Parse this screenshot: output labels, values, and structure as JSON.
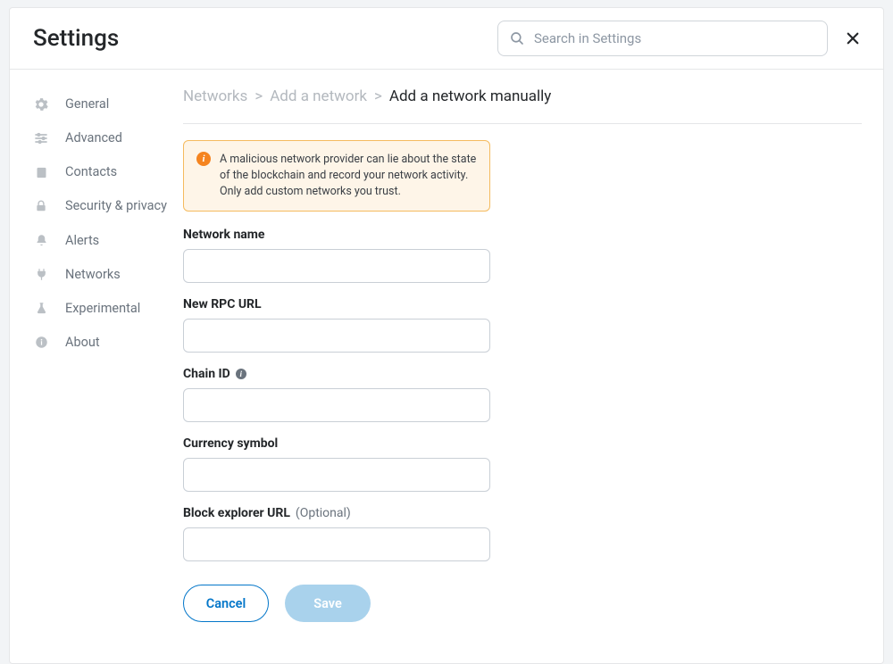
{
  "header": {
    "title": "Settings",
    "searchPlaceholder": "Search in Settings"
  },
  "sidebar": {
    "items": [
      {
        "icon": "gear-icon",
        "label": "General"
      },
      {
        "icon": "sliders-icon",
        "label": "Advanced"
      },
      {
        "icon": "contacts-icon",
        "label": "Contacts"
      },
      {
        "icon": "lock-icon",
        "label": "Security & privacy"
      },
      {
        "icon": "bell-icon",
        "label": "Alerts"
      },
      {
        "icon": "plug-icon",
        "label": "Networks"
      },
      {
        "icon": "flask-icon",
        "label": "Experimental"
      },
      {
        "icon": "info-icon",
        "label": "About"
      }
    ]
  },
  "breadcrumb": {
    "crumb0": "Networks",
    "crumb1": "Add a network",
    "current": "Add a network manually",
    "sep": ">"
  },
  "warning": {
    "text": "A malicious network provider can lie about the state of the blockchain and record your network activity. Only add custom networks you trust."
  },
  "form": {
    "networkName": {
      "label": "Network name"
    },
    "rpcUrl": {
      "label": "New RPC URL"
    },
    "chainId": {
      "label": "Chain ID"
    },
    "currency": {
      "label": "Currency symbol"
    },
    "explorer": {
      "label": "Block explorer URL",
      "optional": "(Optional)"
    }
  },
  "actions": {
    "cancel": "Cancel",
    "save": "Save"
  }
}
